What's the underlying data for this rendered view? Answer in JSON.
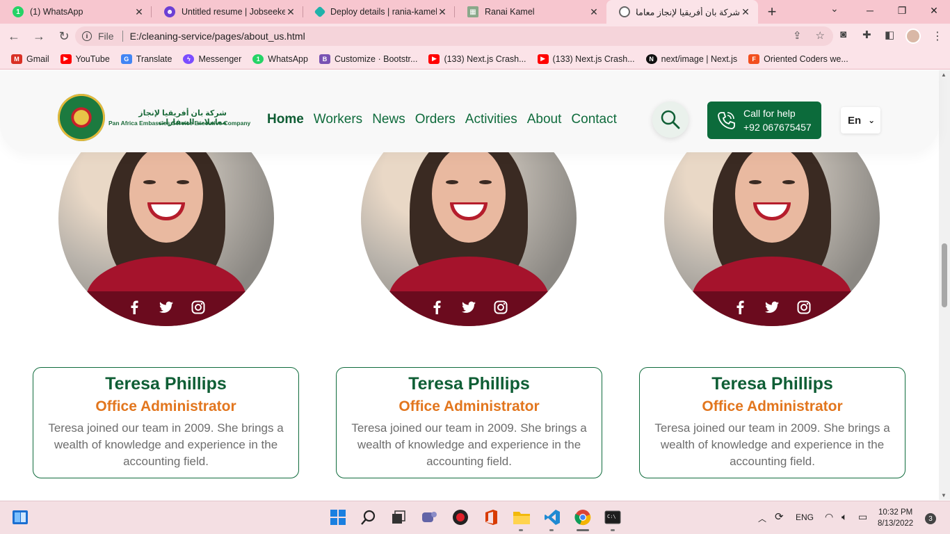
{
  "browser": {
    "tabs": [
      {
        "title": "(1) WhatsApp",
        "icon": "whatsapp-icon",
        "color": "#25d366",
        "glyph": "1"
      },
      {
        "title": "Untitled resume | Jobseeker",
        "icon": "jobseeker-icon",
        "color": "#6b3fd4",
        "glyph": "☻"
      },
      {
        "title": "Deploy details | rania-kamel-",
        "icon": "netlify-icon",
        "color": "#20b2aa",
        "glyph": "◆"
      },
      {
        "title": "Ranai Kamel",
        "icon": "page-icon",
        "color": "#8aa88a",
        "glyph": "▦"
      },
      {
        "title": "شركة بان أفريقيا لإنجاز معاملات",
        "icon": "globe-icon",
        "color": "#666666",
        "glyph": "◐"
      }
    ],
    "address": {
      "scheme_label": "File",
      "url": "E:/cleaning-service/pages/about_us.html"
    },
    "bookmarks": [
      {
        "label": "Gmail",
        "icon": "gmail-icon",
        "color": "#d93025",
        "glyph": "M"
      },
      {
        "label": "YouTube",
        "icon": "youtube-icon",
        "color": "#ff0000",
        "glyph": "▶"
      },
      {
        "label": "Translate",
        "icon": "translate-icon",
        "color": "#4285f4",
        "glyph": "G"
      },
      {
        "label": "Messenger",
        "icon": "messenger-icon",
        "color": "#7b4dff",
        "glyph": "ϟ"
      },
      {
        "label": "WhatsApp",
        "icon": "whatsapp-icon",
        "color": "#25d366",
        "glyph": "1"
      },
      {
        "label": "Customize · Bootstr...",
        "icon": "bootstrap-icon",
        "color": "#7952b3",
        "glyph": "B"
      },
      {
        "label": "(133) Next.js Crash...",
        "icon": "youtube-icon",
        "color": "#ff0000",
        "glyph": "▶"
      },
      {
        "label": "(133) Next.js Crash...",
        "icon": "youtube-icon",
        "color": "#ff0000",
        "glyph": "▶"
      },
      {
        "label": "next/image | Next.js",
        "icon": "nextjs-icon",
        "color": "#111111",
        "glyph": "N"
      },
      {
        "label": "Oriented Coders we...",
        "icon": "figma-icon",
        "color": "#f24e1e",
        "glyph": "F"
      }
    ]
  },
  "site": {
    "logo_arabic": "شركة بان أفريقيا لإنجاز معاملات السفارات",
    "logo_english": "Pan Africa Embassies Service Executive Company",
    "nav": [
      "Home",
      "Workers",
      "News",
      "Orders",
      "Activities",
      "About",
      "Contact"
    ],
    "call": {
      "line1": "Call for help",
      "line2": "+92 067675457"
    },
    "lang": "En"
  },
  "team": [
    {
      "name": "Teresa Phillips",
      "role": "Office Administrator",
      "bio": "Teresa joined our team in 2009. She brings a wealth of knowledge and experience in the accounting field."
    },
    {
      "name": "Teresa Phillips",
      "role": "Office Administrator",
      "bio": "Teresa joined our team in 2009. She brings a wealth of knowledge and experience in the accounting field."
    },
    {
      "name": "Teresa Phillips",
      "role": "Office Administrator",
      "bio": "Teresa joined our team in 2009. She brings a wealth of knowledge and experience in the accounting field."
    }
  ],
  "taskbar": {
    "lang": "ENG",
    "time": "10:32 PM",
    "date": "8/13/2022",
    "notifications": "3"
  },
  "colors": {
    "brand_green": "#0f6b3c",
    "accent_orange": "#e2761e",
    "tab_strip": "#f7c6cf"
  }
}
